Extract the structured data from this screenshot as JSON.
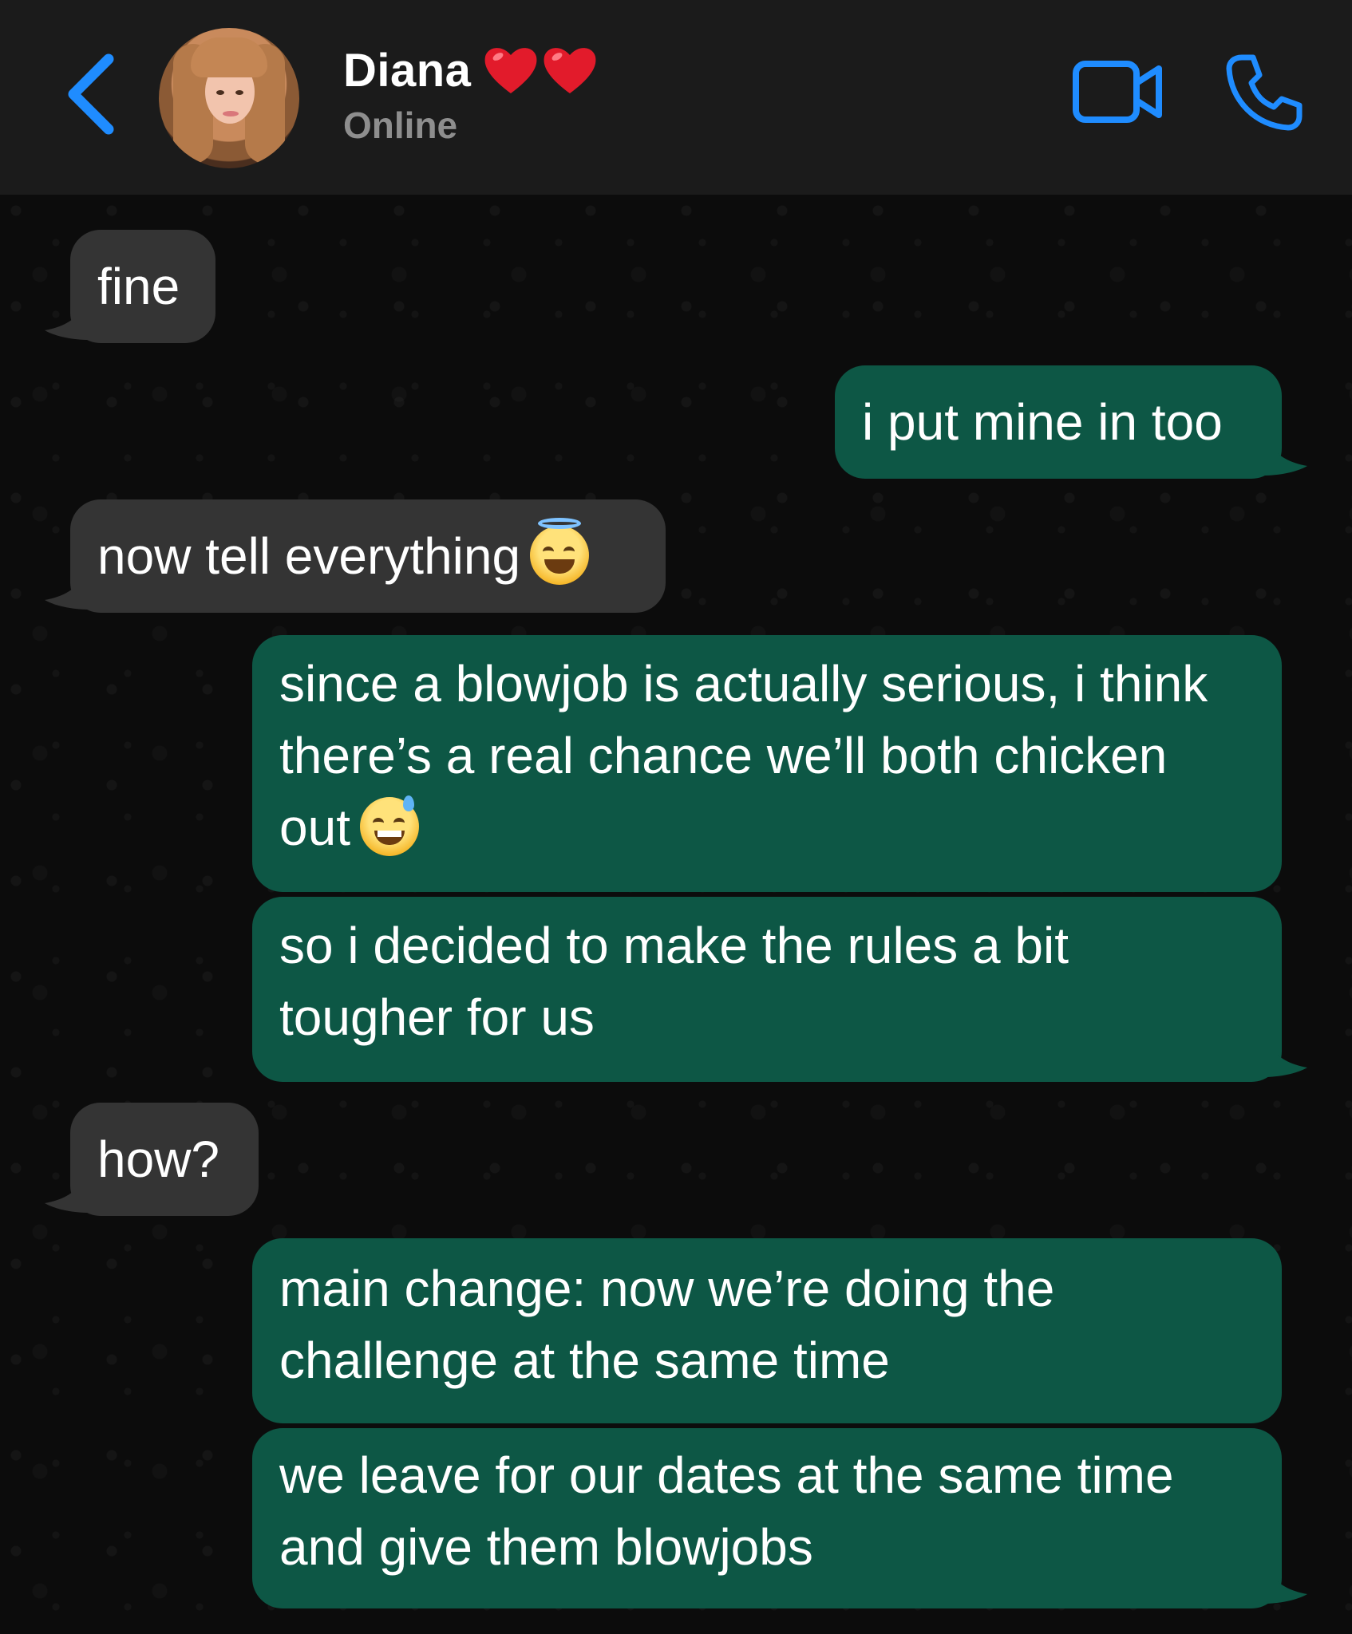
{
  "header": {
    "contact_name": "Diana",
    "status": "Online",
    "accent_color": "#1f8cff",
    "icons": [
      "back-icon",
      "heart-icon",
      "heart-icon",
      "video-call-icon",
      "phone-icon"
    ]
  },
  "messages": [
    {
      "direction": "incoming",
      "text": "fine"
    },
    {
      "direction": "outgoing",
      "text": "i put mine in too"
    },
    {
      "direction": "incoming",
      "text": "now tell everything",
      "emoji": "smiling-face-with-halo"
    },
    {
      "direction": "outgoing",
      "text": "since a blowjob is actually serious, i think there’s a real chance we’ll both chicken out",
      "emoji": "grinning-face-with-sweat"
    },
    {
      "direction": "outgoing",
      "text": "so i decided to make the rules a bit tougher for us"
    },
    {
      "direction": "incoming",
      "text": "how?"
    },
    {
      "direction": "outgoing",
      "text": "main change: now we’re doing the challenge at the same time"
    },
    {
      "direction": "outgoing",
      "text": "we leave for our dates at the same time and give them blowjobs"
    }
  ],
  "colors": {
    "incoming_bubble": "#343434",
    "outgoing_bubble": "#0d5745",
    "header_bg": "#1b1b1b",
    "chat_bg": "#0c0c0c"
  }
}
